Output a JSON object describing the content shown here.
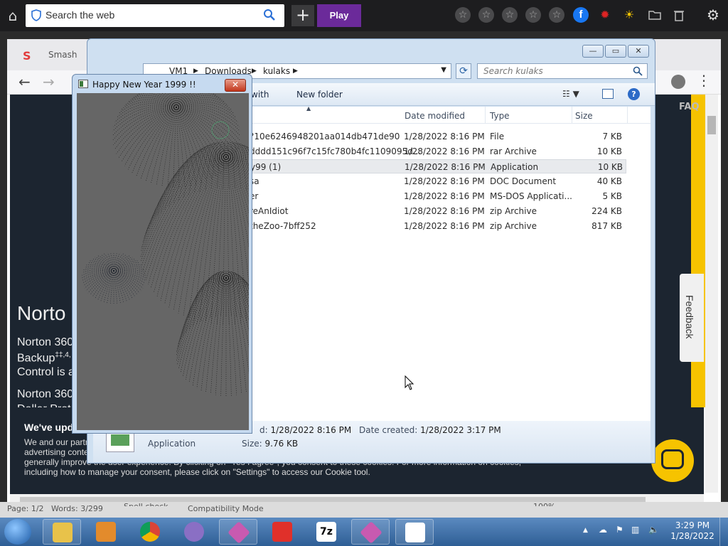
{
  "topbar": {
    "search_placeholder": "Search the web",
    "play_label": "Play"
  },
  "browser": {
    "tab_label": "Smash",
    "faq": "FAQ",
    "norton_title": "Norto",
    "norton_lines": [
      "Norton 360",
      "Backup",
      "Control is a",
      "Norton 360",
      "Dollar Prot"
    ],
    "backup_superscript": "‡‡,4,",
    "cookie_title": "We've upd",
    "cookie_lines": [
      "We and our partn",
      "advertising conte",
      "generally improve the user experience. By clicking on \"Yes I agree\", you consent to these cookies. For more information on cookies,",
      "including how to manage your consent, please click on \"Settings\" to access our Cookie tool."
    ],
    "feedback": "Feedback"
  },
  "word_status": {
    "page": "Page: 1/2",
    "words": "Words: 3/299",
    "mode": "Compatibility Mode",
    "zoom": "100%",
    "track": "Spell check"
  },
  "explorer": {
    "breadcrumb": [
      "VM1",
      "Downloads",
      "kulaks"
    ],
    "search_placeholder": "Search kulaks",
    "cmd_open_with": "with",
    "cmd_new_folder": "New folder",
    "columns": {
      "date": "Date modified",
      "type": "Type",
      "size": "Size"
    },
    "files": [
      {
        "name": "?10e6246948201aa014db471de90",
        "date": "1/28/2022 8:16 PM",
        "type": "File",
        "size": "7 KB"
      },
      {
        "name": "dddd151c96f7c15fc780b4fc1109095d...",
        "date": "1/28/2022 8:16 PM",
        "type": "rar Archive",
        "size": "10 KB"
      },
      {
        "name": "y99 (1)",
        "date": "1/28/2022 8:16 PM",
        "type": "Application",
        "size": "10 KB"
      },
      {
        "name": "sa",
        "date": "1/28/2022 8:16 PM",
        "type": "DOC Document",
        "size": "40 KB"
      },
      {
        "name": "er",
        "date": "1/28/2022 8:16 PM",
        "type": "MS-DOS Applicati...",
        "size": "5 KB"
      },
      {
        "name": "reAnIdiot",
        "date": "1/28/2022 8:16 PM",
        "type": "zip Archive",
        "size": "224 KB"
      },
      {
        "name": "theZoo-7bff252",
        "date": "1/28/2022 8:16 PM",
        "type": "zip Archive",
        "size": "817 KB"
      }
    ],
    "selected_index": 2,
    "details": {
      "modified_label": "d:",
      "modified_value": "1/28/2022 8:16 PM",
      "created_label": "Date created:",
      "created_value": "1/28/2022 3:17 PM",
      "type_value": "Application",
      "size_label": "Size:",
      "size_value": "9.76 KB"
    }
  },
  "popup": {
    "title": "Happy New Year 1999 !!"
  },
  "taskbar": {
    "time": "3:29 PM",
    "date": "1/28/2022"
  },
  "colors": {
    "play": "#6b2a9a",
    "norton_yellow": "#f6c300",
    "taskbar": "#2e5e95",
    "popup_bg": "#666666"
  }
}
